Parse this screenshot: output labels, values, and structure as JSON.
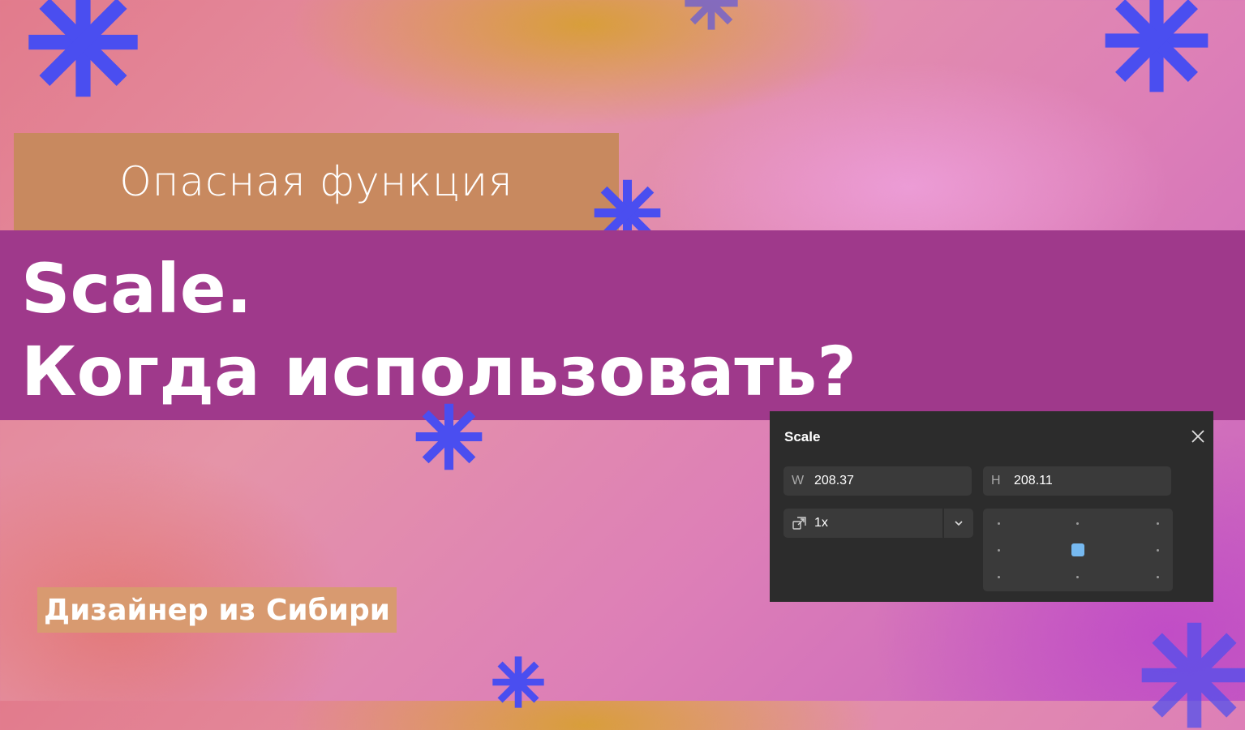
{
  "subtitle": "Опасная функция",
  "title": {
    "line1": "Scale.",
    "line2": "Когда использовать?"
  },
  "author": "Дизайнер из Сибири",
  "scale_panel": {
    "title": "Scale",
    "width_label": "W",
    "width_value": "208.37",
    "height_label": "H",
    "height_value": "208.11",
    "scale_value": "1x",
    "anchor_selected": "center"
  },
  "colors": {
    "snowflake": "#4a4ef0",
    "title_band": "#9f398b",
    "subtitle_box": "#c8895f",
    "author_box": "#d89a70",
    "panel_bg": "#2c2c2c",
    "anchor_accent": "#76b9f0"
  },
  "icons": {
    "snowflake": "snowflake-icon",
    "close": "close-icon",
    "scale": "scale-icon",
    "dropdown": "chevron-down-icon"
  }
}
